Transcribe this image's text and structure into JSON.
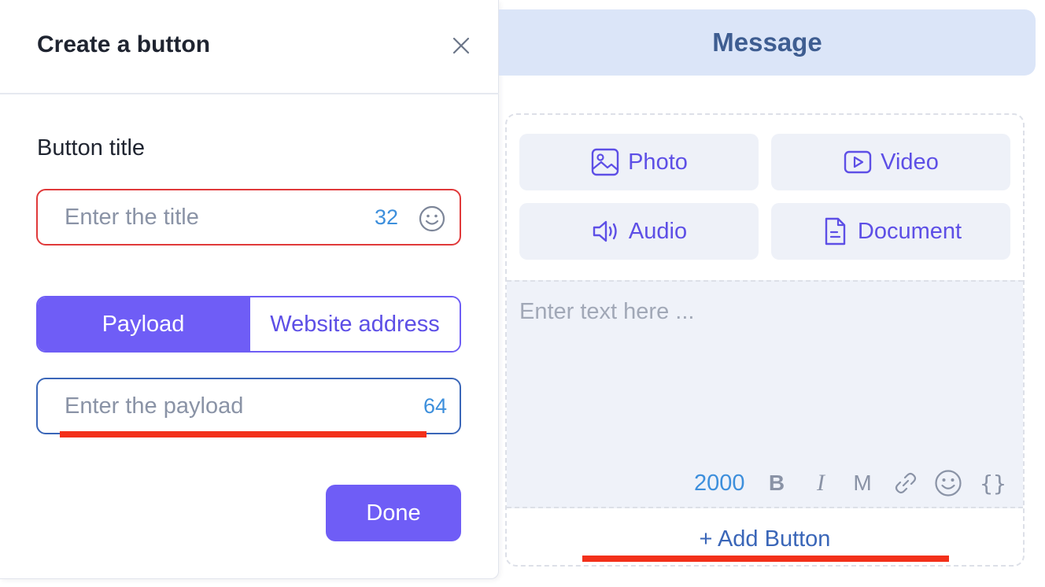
{
  "panel": {
    "title": "Create a button",
    "field_label": "Button title",
    "title_input": {
      "placeholder": "Enter the title",
      "counter": "32"
    },
    "toggle": {
      "options": [
        "Payload",
        "Website address"
      ],
      "selected": "Payload"
    },
    "payload_input": {
      "placeholder": "Enter the payload",
      "counter": "64"
    },
    "done_label": "Done"
  },
  "message": {
    "header": "Message",
    "media_buttons": [
      {
        "label": "Photo",
        "icon": "image-icon"
      },
      {
        "label": "Video",
        "icon": "video-icon"
      },
      {
        "label": "Audio",
        "icon": "audio-icon"
      },
      {
        "label": "Document",
        "icon": "document-icon"
      }
    ],
    "text_placeholder": "Enter text here ...",
    "toolbar": {
      "counter": "2000",
      "bold": "B",
      "italic": "I",
      "mono": "M",
      "variable": "{}"
    },
    "add_button_label": "+ Add Button"
  },
  "colors": {
    "accent": "#6f5df6",
    "error_border": "#e0393a",
    "counter_blue": "#3d8fdc",
    "annotation_red": "#f3301a",
    "header_bg": "#dbe5f8"
  }
}
